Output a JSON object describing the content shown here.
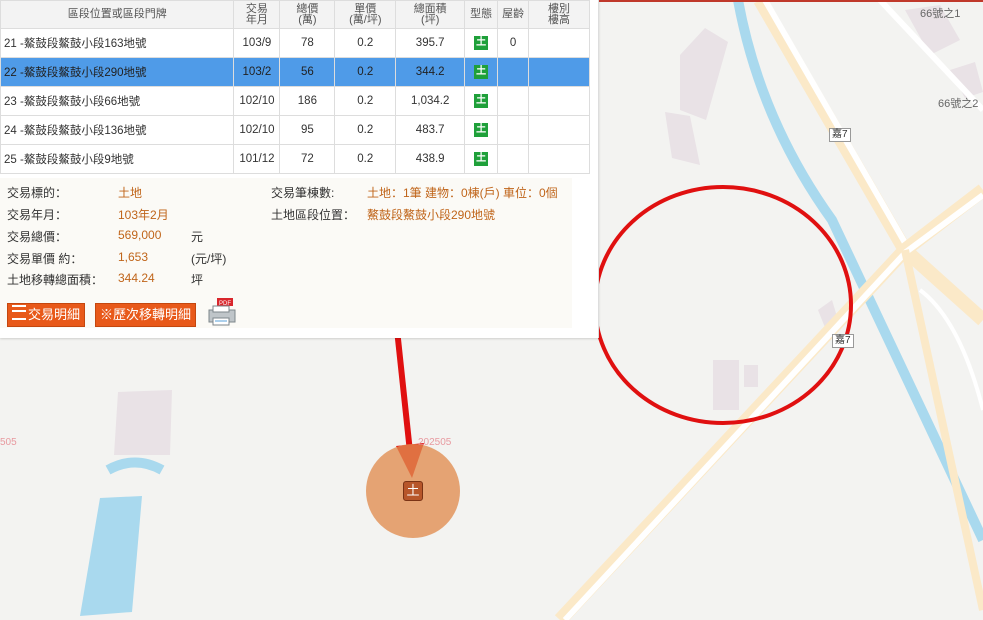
{
  "table": {
    "headers": {
      "location": "區段位置或區段門牌",
      "date_l1": "交易",
      "date_l2": "年月",
      "total_l1": "總價",
      "total_l2": "(萬)",
      "unit_l1": "單價",
      "unit_l2": "(萬/坪)",
      "area_l1": "總面積",
      "area_l2": "(坪)",
      "type": "型態",
      "age": "屋齡",
      "floor_l1": "樓別",
      "floor_l2": "樓高"
    },
    "rows": [
      {
        "location": "21 -鰲鼓段鰲鼓小段163地號",
        "date": "103/9",
        "total": "78",
        "unit": "0.2",
        "area": "395.7",
        "type": "土",
        "age": "0",
        "floor": ""
      },
      {
        "location": "22 -鰲鼓段鰲鼓小段290地號",
        "date": "103/2",
        "total": "56",
        "unit": "0.2",
        "area": "344.2",
        "type": "土",
        "age": "",
        "floor": ""
      },
      {
        "location": "23 -鰲鼓段鰲鼓小段66地號",
        "date": "102/10",
        "total": "186",
        "unit": "0.2",
        "area": "1,034.2",
        "type": "土",
        "age": "",
        "floor": ""
      },
      {
        "location": "24 -鰲鼓段鰲鼓小段136地號",
        "date": "102/10",
        "total": "95",
        "unit": "0.2",
        "area": "483.7",
        "type": "土",
        "age": "",
        "floor": ""
      },
      {
        "location": "25 -鰲鼓段鰲鼓小段9地號",
        "date": "101/12",
        "total": "72",
        "unit": "0.2",
        "area": "438.9",
        "type": "土",
        "age": "",
        "floor": ""
      }
    ]
  },
  "detail": {
    "subject_label": "交易標的：",
    "subject_value": "土地",
    "date_label": "交易年月：",
    "date_value": "103年2月",
    "total_label": "交易總價：",
    "total_value": "569,000",
    "total_unit": "元",
    "unit_label": "交易單價 約：",
    "unit_value": "1,653",
    "unit_unit": "(元/坪)",
    "area_label": "土地移轉總面積：",
    "area_value": "344.24",
    "area_unit": "坪",
    "count_label": "交易筆棟數:",
    "count_value": "土地：1筆 建物：0棟(戶) 車位：0個",
    "land_loc_label": "土地區段位置：",
    "land_loc_value": "鰲鼓段鰲鼓小段290地號"
  },
  "buttons": {
    "detail": "交易明細",
    "history": "※歷次移轉明細"
  },
  "map": {
    "label_66_1": "66號之1",
    "label_66_2": "66號之2",
    "road_7": "嘉7",
    "road_7b": "嘉7",
    "parcel_1": "202505",
    "parcel_2": "505",
    "marker_type": "土"
  },
  "icons": {
    "pdf": "pdf-print-icon",
    "list": "list-icon"
  },
  "colors": {
    "selected_row": "#4f9be8",
    "accent": "#e8591a",
    "annotation": "#e01010",
    "land_tag": "#1fa03a"
  }
}
